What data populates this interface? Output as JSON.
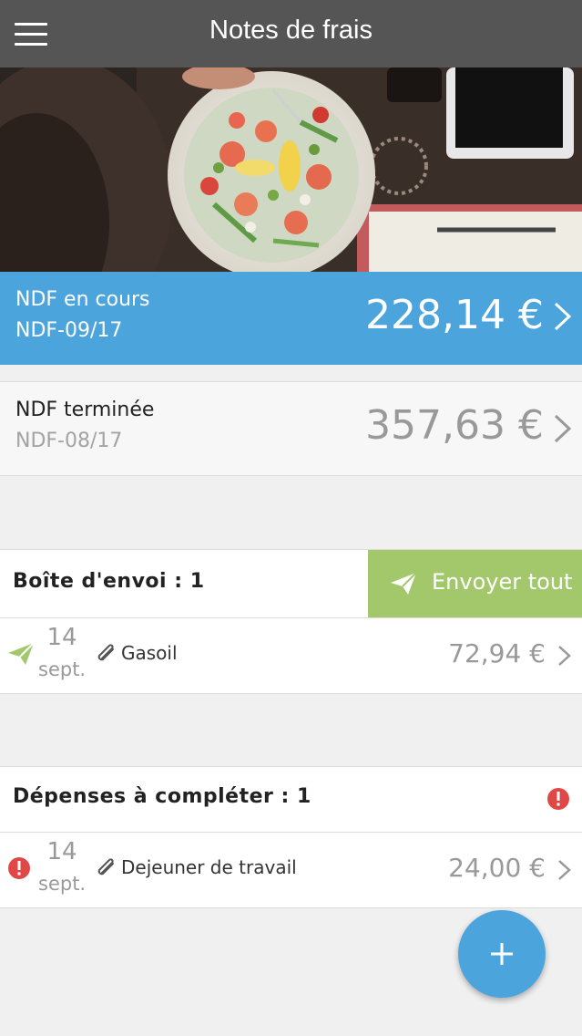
{
  "header": {
    "title": "Notes de frais",
    "menu_icon": "hamburger-menu-icon"
  },
  "banner": {
    "description_icon": "food-photo"
  },
  "ndf_current": {
    "label": "NDF en cours",
    "reference": "NDF-09/17",
    "amount": "228,14 €"
  },
  "ndf_done": {
    "label": "NDF terminée",
    "reference": "NDF-08/17",
    "amount": "357,63 €"
  },
  "outbox": {
    "title": "Boîte d'envoi : 1",
    "send_all_label": "Envoyer tout",
    "items": [
      {
        "day": "14",
        "month": "sept.",
        "label": "Gasoil",
        "amount": "72,94 €"
      }
    ]
  },
  "to_complete": {
    "title": "Dépenses à compléter : 1",
    "items": [
      {
        "day": "14",
        "month": "sept.",
        "label": "Dejeuner de travail",
        "amount": "24,00 €"
      }
    ]
  },
  "colors": {
    "accent_blue": "#4ca4dd",
    "send_green": "#a3c86b",
    "warning_red": "#e04848",
    "header_gray": "#555555"
  }
}
